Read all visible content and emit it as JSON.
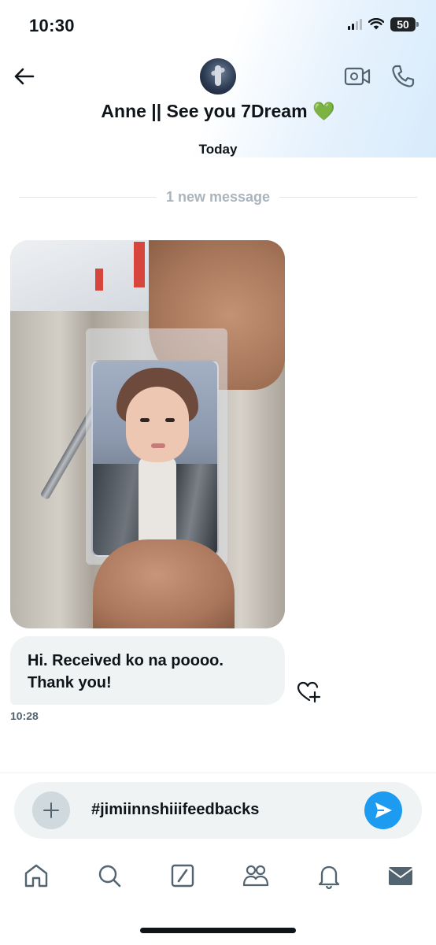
{
  "status_bar": {
    "time": "10:30",
    "battery": "50"
  },
  "header": {
    "contact_name": "Anne || See you 7Dream",
    "name_emoji": "💚"
  },
  "conversation": {
    "date_label": "Today",
    "new_message_divider": "1 new message",
    "message_text_line1": "Hi. Received ko na poooo.",
    "message_text_line2": "Thank you!",
    "message_time": "10:28"
  },
  "composer": {
    "text": "#jimiinnshiiifeedbacks"
  },
  "icons": {
    "back": "arrow-left-icon",
    "video": "video-camera-icon",
    "call": "phone-icon",
    "react": "heart-plus-icon",
    "add": "plus-icon",
    "send": "send-icon",
    "tabs": [
      "home-icon",
      "search-icon",
      "compose-icon",
      "communities-icon",
      "bell-icon",
      "mail-icon"
    ]
  },
  "colors": {
    "accent": "#1d9bf0",
    "bubble_bg": "#eff3f4",
    "muted_text": "#536471",
    "divider_text": "#aab4bd",
    "emoji_green": "#5fbd47"
  }
}
